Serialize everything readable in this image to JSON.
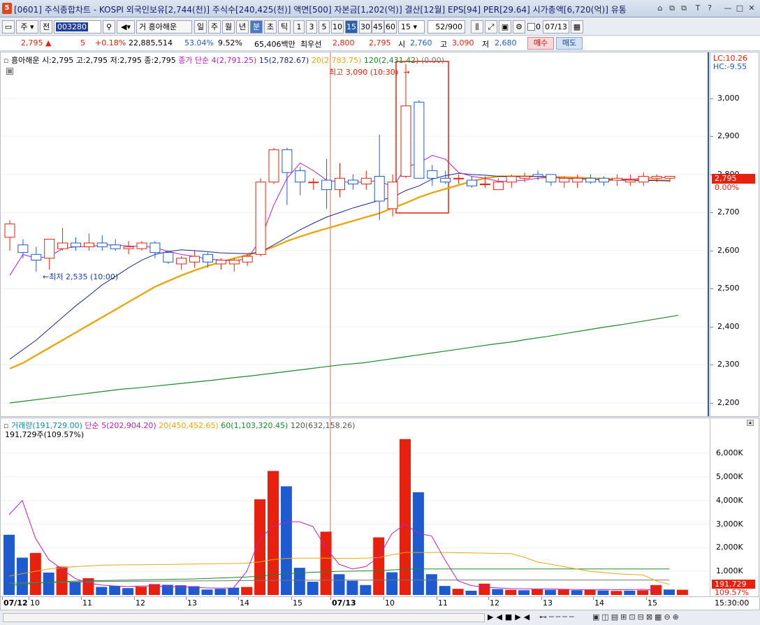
{
  "window": {
    "icon_label": "5",
    "title": "[0601] 주식종합차트 - KOSPI 외국인보유[2,744(천)] 주식수[240,425(천)] 액면[500] 자본금[1,202(억)] 결산[12월] EPS[94] PER[29.64] 시가총액[6,720(억)] 유통",
    "controls": [
      "⌂",
      "⧉",
      "⧉",
      "T",
      "?",
      "—",
      "□",
      "✕"
    ]
  },
  "toolbar": {
    "mode1": "주",
    "mode2": "전",
    "code": "003280",
    "search_icon": "search-icon",
    "name_prefix": "거",
    "stock_name": "흥아해운",
    "periods": [
      "일",
      "주",
      "월",
      "년",
      "분",
      "초",
      "틱"
    ],
    "minutes": [
      "1",
      "3",
      "5",
      "10",
      "15",
      "30",
      "45",
      "60"
    ],
    "interval": "15",
    "count": "52/900",
    "checkbox_label": "0",
    "date": "07/13"
  },
  "quote": {
    "price": "2,795",
    "change": "5",
    "change_pct": "+0.18%",
    "volume": "22,885,514",
    "vol_pct": "53.04%",
    "turnover": "9.52%",
    "amount": "65,406백만",
    "ask_label": "최우선",
    "ask": "2,800",
    "bid": "2,795",
    "open_label": "시",
    "open": "2,760",
    "high_label": "고",
    "high": "3,090",
    "low_label": "저",
    "low": "2,680",
    "buy": "매수",
    "sell": "매도"
  },
  "price_legend": {
    "ohlc": "흥아해운 시:2,795 고:2,795 저:2,795 종:2,795",
    "ma_prefix": "종가 단순 4(2,791.25)",
    "ma15": "15(2,782.67)",
    "ma20": "20(2,783.75)",
    "ma120": "120(2,431.42)",
    "ma_extra": "(0.00)",
    "lc": "LC:10.26",
    "hc": "HC:-9.55"
  },
  "annotations": {
    "high": "최고 3,090 (10:30)",
    "low": "최저 2,535 (10:00)"
  },
  "volume_legend": {
    "label": "거래량(191,729.00)",
    "ma5": "단순 5(202,904.20)",
    "ma20": "20(450,452.65)",
    "ma60": "60(1,103,320.45)",
    "ma120": "120(632,158.26)",
    "info": "191,729주(109.57%)"
  },
  "price_axis_marker": {
    "price": "2,795",
    "pct": "0.00%"
  },
  "volume_axis_marker": {
    "value": "191,729",
    "pct": "109.57%"
  },
  "colors": {
    "up": "#e8210e",
    "down": "#1e5ad0",
    "ma4": "#c01cc0",
    "ma15": "#1a2a8a",
    "ma20": "#e8a810",
    "ma120": "#1a8a2a"
  },
  "chart_data": [
    {
      "type": "candlestick",
      "title": "흥아해운",
      "x_ticks": [
        "07/12",
        "10",
        "11",
        "12",
        "13",
        "14",
        "15",
        "07/13",
        "10",
        "11",
        "12",
        "13",
        "14",
        "15"
      ],
      "y_ticks": [
        "3,000",
        "2,900",
        "2,800",
        "2,700",
        "2,600",
        "2,500",
        "2,400",
        "2,300",
        "2,200"
      ],
      "ylim": [
        2180,
        3110
      ],
      "candles": [
        {
          "o": 2635,
          "h": 2680,
          "l": 2600,
          "c": 2670
        },
        {
          "o": 2615,
          "h": 2630,
          "l": 2580,
          "c": 2595
        },
        {
          "o": 2590,
          "h": 2610,
          "l": 2545,
          "c": 2575
        },
        {
          "o": 2580,
          "h": 2625,
          "l": 2550,
          "c": 2630
        },
        {
          "o": 2605,
          "h": 2660,
          "l": 2600,
          "c": 2620
        },
        {
          "o": 2620,
          "h": 2635,
          "l": 2600,
          "c": 2610
        },
        {
          "o": 2610,
          "h": 2645,
          "l": 2600,
          "c": 2620
        },
        {
          "o": 2620,
          "h": 2640,
          "l": 2600,
          "c": 2610
        },
        {
          "o": 2615,
          "h": 2630,
          "l": 2600,
          "c": 2605
        },
        {
          "o": 2605,
          "h": 2625,
          "l": 2590,
          "c": 2610
        },
        {
          "o": 2605,
          "h": 2625,
          "l": 2600,
          "c": 2620
        },
        {
          "o": 2620,
          "h": 2625,
          "l": 2580,
          "c": 2595
        },
        {
          "o": 2595,
          "h": 2600,
          "l": 2565,
          "c": 2570
        },
        {
          "o": 2565,
          "h": 2585,
          "l": 2550,
          "c": 2580
        },
        {
          "o": 2570,
          "h": 2600,
          "l": 2555,
          "c": 2585
        },
        {
          "o": 2590,
          "h": 2595,
          "l": 2555,
          "c": 2570
        },
        {
          "o": 2565,
          "h": 2580,
          "l": 2550,
          "c": 2575
        },
        {
          "o": 2565,
          "h": 2580,
          "l": 2545,
          "c": 2575
        },
        {
          "o": 2570,
          "h": 2590,
          "l": 2560,
          "c": 2585
        },
        {
          "o": 2590,
          "h": 2790,
          "l": 2585,
          "c": 2780
        },
        {
          "o": 2780,
          "h": 2870,
          "l": 2775,
          "c": 2865
        },
        {
          "o": 2865,
          "h": 2870,
          "l": 2720,
          "c": 2805
        },
        {
          "o": 2810,
          "h": 2820,
          "l": 2745,
          "c": 2780
        },
        {
          "o": 2780,
          "h": 2790,
          "l": 2760,
          "c": 2780
        },
        {
          "o": 2785,
          "h": 2840,
          "l": 2710,
          "c": 2760
        },
        {
          "o": 2760,
          "h": 2830,
          "l": 2740,
          "c": 2790
        },
        {
          "o": 2785,
          "h": 2800,
          "l": 2760,
          "c": 2775
        },
        {
          "o": 2775,
          "h": 2810,
          "l": 2760,
          "c": 2790
        },
        {
          "o": 2795,
          "h": 2905,
          "l": 2680,
          "c": 2730
        },
        {
          "o": 2710,
          "h": 2800,
          "l": 2690,
          "c": 2780
        },
        {
          "o": 2795,
          "h": 3090,
          "l": 2790,
          "c": 2980
        },
        {
          "o": 2990,
          "h": 2995,
          "l": 2790,
          "c": 2790
        },
        {
          "o": 2810,
          "h": 2825,
          "l": 2770,
          "c": 2790
        },
        {
          "o": 2790,
          "h": 2810,
          "l": 2775,
          "c": 2780
        },
        {
          "o": 2790,
          "h": 2800,
          "l": 2775,
          "c": 2790
        },
        {
          "o": 2785,
          "h": 2795,
          "l": 2765,
          "c": 2770
        },
        {
          "o": 2775,
          "h": 2795,
          "l": 2765,
          "c": 2775
        },
        {
          "o": 2760,
          "h": 2790,
          "l": 2760,
          "c": 2780
        },
        {
          "o": 2780,
          "h": 2800,
          "l": 2765,
          "c": 2795
        },
        {
          "o": 2790,
          "h": 2805,
          "l": 2780,
          "c": 2795
        },
        {
          "o": 2800,
          "h": 2810,
          "l": 2785,
          "c": 2795
        },
        {
          "o": 2800,
          "h": 2800,
          "l": 2770,
          "c": 2780
        },
        {
          "o": 2780,
          "h": 2795,
          "l": 2765,
          "c": 2790
        },
        {
          "o": 2780,
          "h": 2800,
          "l": 2765,
          "c": 2790
        },
        {
          "o": 2790,
          "h": 2800,
          "l": 2775,
          "c": 2780
        },
        {
          "o": 2790,
          "h": 2795,
          "l": 2770,
          "c": 2780
        },
        {
          "o": 2785,
          "h": 2800,
          "l": 2770,
          "c": 2790
        },
        {
          "o": 2780,
          "h": 2800,
          "l": 2770,
          "c": 2785
        },
        {
          "o": 2780,
          "h": 2805,
          "l": 2770,
          "c": 2795
        },
        {
          "o": 2790,
          "h": 2800,
          "l": 2780,
          "c": 2795
        },
        {
          "o": 2790,
          "h": 2795,
          "l": 2780,
          "c": 2795
        }
      ],
      "ma4": [
        2535,
        2590,
        2580,
        2585,
        2605,
        2610,
        2610,
        2615,
        2615,
        2612,
        2612,
        2608,
        2598,
        2590,
        2585,
        2578,
        2575,
        2574,
        2578,
        2630,
        2720,
        2790,
        2830,
        2810,
        2785,
        2780,
        2780,
        2780,
        2785,
        2765,
        2820,
        2830,
        2850,
        2840,
        2805,
        2795,
        2790,
        2782,
        2782,
        2785,
        2790,
        2792,
        2790,
        2790,
        2788,
        2786,
        2787,
        2787,
        2790,
        2792,
        2791
      ],
      "ma15": [
        2315,
        2340,
        2365,
        2395,
        2425,
        2455,
        2482,
        2510,
        2532,
        2555,
        2575,
        2590,
        2598,
        2602,
        2600,
        2597,
        2594,
        2593,
        2592,
        2596,
        2615,
        2635,
        2655,
        2672,
        2688,
        2700,
        2712,
        2722,
        2732,
        2740,
        2758,
        2770,
        2788,
        2797,
        2803,
        2800,
        2798,
        2795,
        2795,
        2795,
        2795,
        2793,
        2790,
        2788,
        2788,
        2785,
        2785,
        2784,
        2784,
        2784,
        2783
      ],
      "ma20": [
        2290,
        2305,
        2325,
        2345,
        2365,
        2385,
        2405,
        2425,
        2445,
        2465,
        2485,
        2505,
        2520,
        2535,
        2548,
        2560,
        2570,
        2580,
        2588,
        2598,
        2610,
        2625,
        2637,
        2648,
        2658,
        2668,
        2678,
        2688,
        2698,
        2712,
        2725,
        2740,
        2752,
        2762,
        2772,
        2782,
        2790,
        2795,
        2795,
        2795,
        2795,
        2794,
        2793,
        2792,
        2790,
        2789,
        2788,
        2787,
        2786,
        2785,
        2784
      ],
      "ma120": [
        2200,
        2206,
        2212,
        2218,
        2224,
        2230,
        2236,
        2240,
        2245,
        2250,
        2255,
        2260,
        2266,
        2271,
        2277,
        2283,
        2289,
        2295,
        2301,
        2305,
        2312,
        2319,
        2326,
        2333,
        2340,
        2347,
        2354,
        2360,
        2368,
        2375,
        2383,
        2391,
        2399,
        2406,
        2414,
        2422,
        2430
      ]
    },
    {
      "type": "bar",
      "title": "거래량",
      "y_ticks": [
        "6,000K",
        "5,000K",
        "4,000K",
        "3,000K",
        "2,000K",
        "1,000K"
      ],
      "ylim": [
        0,
        6800000
      ],
      "values": [
        2550000,
        1580000,
        1780000,
        950000,
        1200000,
        560000,
        710000,
        340000,
        380000,
        290000,
        350000,
        460000,
        430000,
        410000,
        370000,
        230000,
        260000,
        310000,
        340000,
        4050000,
        5250000,
        4600000,
        1150000,
        560000,
        2680000,
        880000,
        600000,
        420000,
        2440000,
        960000,
        6600000,
        4350000,
        880000,
        380000,
        260000,
        180000,
        480000,
        250000,
        220000,
        200000,
        240000,
        220000,
        230000,
        200000,
        210000,
        190000,
        170000,
        180000,
        200000,
        420000,
        230000,
        220000
      ],
      "up": [
        false,
        false,
        true,
        false,
        true,
        false,
        true,
        false,
        false,
        false,
        true,
        true,
        false,
        false,
        false,
        false,
        false,
        false,
        true,
        true,
        true,
        false,
        false,
        false,
        true,
        false,
        false,
        false,
        true,
        false,
        true,
        false,
        false,
        false,
        true,
        false,
        true,
        false,
        true,
        false,
        true,
        false,
        true,
        false,
        true,
        false,
        true,
        false,
        true,
        true,
        false,
        true
      ],
      "ma5": [
        3400000,
        4000000,
        2400000,
        1500000,
        1100000,
        700000,
        500000,
        420000,
        380000,
        360000,
        380000,
        380000,
        360000,
        340000,
        320000,
        300000,
        290000,
        300000,
        1000000,
        2400000,
        2900000,
        3100000,
        3100000,
        2900000,
        2000000,
        1300000,
        1100000,
        1200000,
        1600000,
        2600000,
        3000000,
        2600000,
        2500000,
        1500000,
        600000,
        400000,
        330000,
        300000,
        270000,
        260000,
        260000,
        260000,
        240000,
        230000,
        220000,
        230000,
        220000,
        220000,
        240000,
        200000
      ],
      "ma20": [
        800000,
        900000,
        1000000,
        1100000,
        1150000,
        1200000,
        1230000,
        1260000,
        1270000,
        1280000,
        1280000,
        1290000,
        1290000,
        1300000,
        1310000,
        1320000,
        1330000,
        1330000,
        1350000,
        1400000,
        1500000,
        1550000,
        1560000,
        1560000,
        1560000,
        1550000,
        1550000,
        1560000,
        1580000,
        1700000,
        1800000,
        1800000,
        1800000,
        1800000,
        1790000,
        1780000,
        1770000,
        1760000,
        1750000,
        1600000,
        1400000,
        1300000,
        1200000,
        1100000,
        1000000,
        950000,
        900000,
        870000,
        850000,
        600000,
        450000
      ],
      "ma60": [
        400000,
        450000,
        500000,
        540000,
        570000,
        590000,
        600000,
        610000,
        620000,
        630000,
        640000,
        650000,
        660000,
        670000,
        680000,
        700000,
        720000,
        740000,
        760000,
        800000,
        850000,
        900000,
        930000,
        960000,
        980000,
        1000000,
        1010000,
        1020000,
        1030000,
        1060000,
        1090000,
        1100000,
        1100000,
        1100000,
        1100000,
        1100000,
        1100000,
        1100000,
        1100000,
        1100000,
        1100000,
        1100000,
        1100000,
        1100000,
        1100000,
        1100000,
        1100000,
        1100000,
        1103000,
        1103000,
        1103000
      ],
      "ma120": [
        500000,
        510000,
        520000,
        530000,
        540000,
        550000,
        560000,
        570000,
        575000,
        580000,
        580000,
        585000,
        590000,
        590000,
        595000,
        600000,
        600000,
        605000,
        610000,
        615000,
        620000,
        625000,
        625000,
        625000,
        630000,
        630000,
        630000,
        630000,
        632000,
        632000,
        632000,
        632000,
        632000,
        632000,
        632000,
        632000,
        632000,
        632000,
        632000,
        632000,
        632000,
        632000,
        632000,
        632000,
        632000,
        632000,
        632000,
        632000,
        632000,
        632000,
        632000
      ]
    }
  ],
  "time_axis_label": "15:30:00"
}
